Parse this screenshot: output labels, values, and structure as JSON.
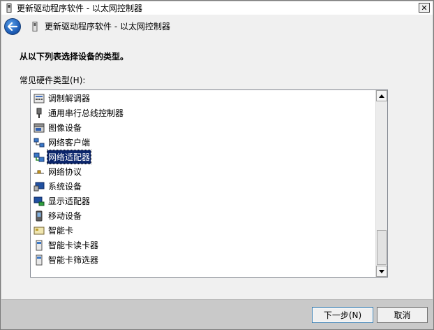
{
  "window": {
    "title": "更新驱动程序软件 - 以太网控制器",
    "close_glyph": "✕"
  },
  "nav": {
    "title": "更新驱动程序软件 - 以太网控制器"
  },
  "main": {
    "heading": "从以下列表选择设备的类型。",
    "list_label": "常见硬件类型(H):",
    "items": [
      {
        "label": "调制解调器",
        "icon": "modem-icon"
      },
      {
        "label": "通用串行总线控制器",
        "icon": "usb-icon"
      },
      {
        "label": "图像设备",
        "icon": "scanner-icon"
      },
      {
        "label": "网络客户端",
        "icon": "network-client-icon"
      },
      {
        "label": "网络适配器",
        "icon": "network-adapter-icon",
        "selected": true
      },
      {
        "label": "网络协议",
        "icon": "network-protocol-icon"
      },
      {
        "label": "系统设备",
        "icon": "system-device-icon"
      },
      {
        "label": "显示适配器",
        "icon": "display-adapter-icon"
      },
      {
        "label": "移动设备",
        "icon": "mobile-device-icon"
      },
      {
        "label": "智能卡",
        "icon": "smart-card-icon"
      },
      {
        "label": "智能卡读卡器",
        "icon": "smart-card-reader-icon"
      },
      {
        "label": "智能卡筛选器",
        "icon": "smart-card-filter-icon"
      }
    ]
  },
  "footer": {
    "next_label": "下一步(N)",
    "cancel_label": "取消"
  },
  "colors": {
    "selection": "#0a246a",
    "back_button": "#1f5fb8"
  }
}
